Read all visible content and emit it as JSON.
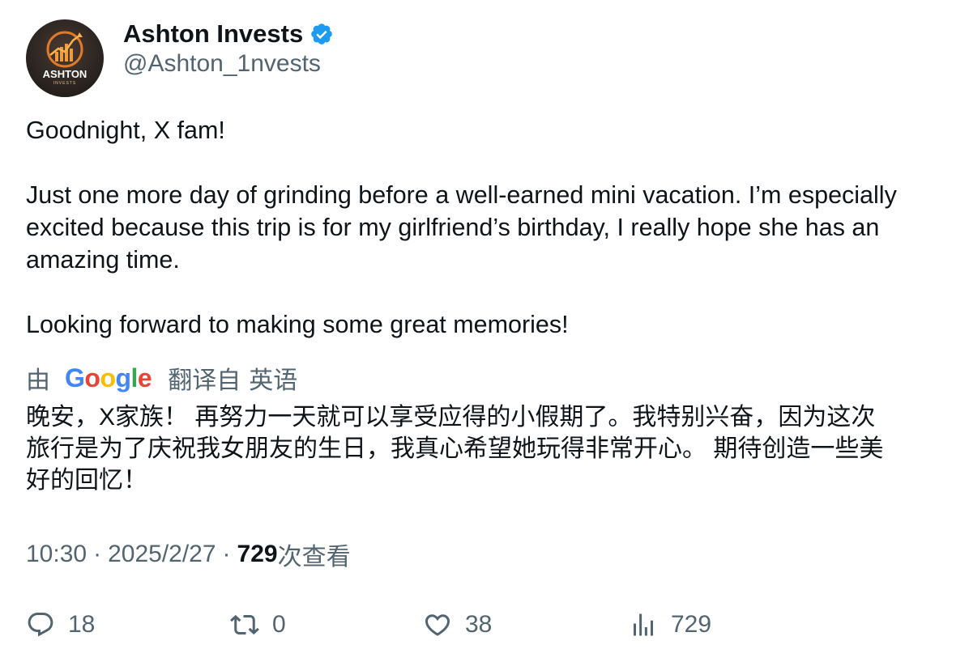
{
  "account": {
    "display_name": "Ashton Invests",
    "handle": "@Ashton_1nvests",
    "avatar_text": "ASHTON",
    "avatar_subtext": "INVESTS",
    "verified": true
  },
  "tweet": {
    "lines": [
      "Goodnight, X fam!",
      "",
      "Just one more day of grinding before a well-earned mini vacation. I’m especially",
      "excited because this trip is for my girlfriend’s birthday, I really hope she has an",
      "amazing time.",
      "",
      "Looking forward to making some great memories!"
    ]
  },
  "translation": {
    "by_label": "由",
    "provider": "Google",
    "from_label": "翻译自",
    "language": "英语",
    "lines": [
      "晚安，X家族！ 再努力一天就可以享受应得的小假期了。我特别兴奋，因为这次",
      "旅行是为了庆祝我女朋友的生日，我真心希望她玩得非常开心。 期待创造一些美",
      "好的回忆！"
    ]
  },
  "meta": {
    "time": "10:30",
    "date": "2025/2/27",
    "views_count": "729",
    "views_label": "次查看"
  },
  "actions": {
    "replies": "18",
    "reposts": "0",
    "likes": "38",
    "views": "729"
  },
  "colors": {
    "text": "#0f1419",
    "secondary": "#536471",
    "verified_blue": "#1d9bf0"
  }
}
